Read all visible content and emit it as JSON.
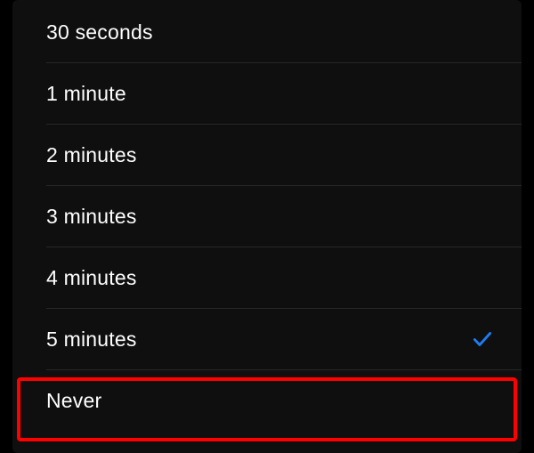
{
  "options": [
    {
      "id": "30-seconds",
      "label": "30 seconds",
      "selected": false
    },
    {
      "id": "1-minute",
      "label": "1 minute",
      "selected": false
    },
    {
      "id": "2-minutes",
      "label": "2 minutes",
      "selected": false
    },
    {
      "id": "3-minutes",
      "label": "3 minutes",
      "selected": false
    },
    {
      "id": "4-minutes",
      "label": "4 minutes",
      "selected": false
    },
    {
      "id": "5-minutes",
      "label": "5 minutes",
      "selected": true
    },
    {
      "id": "never",
      "label": "Never",
      "selected": false
    }
  ],
  "colors": {
    "accent": "#1f7cf4",
    "highlight": "#ff0000",
    "background": "#0f0f10"
  },
  "highlighted_option_id": "never"
}
